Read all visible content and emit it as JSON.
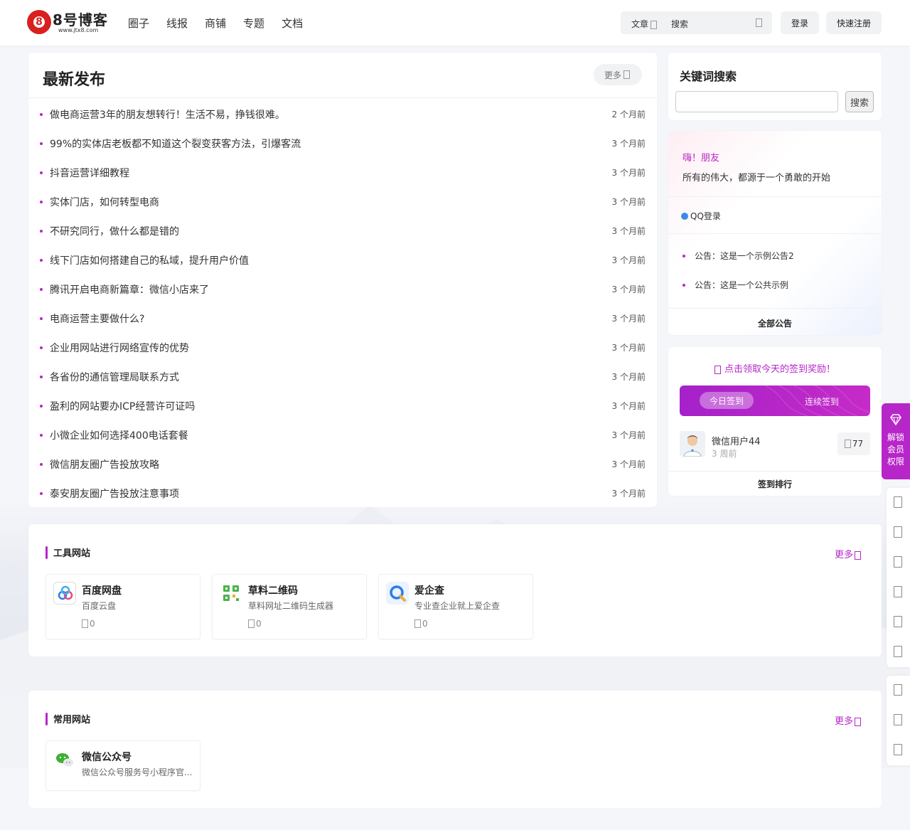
{
  "header": {
    "logo_text": "8号博客",
    "logo_sub": "www.jtx8.com",
    "nav": [
      "圈子",
      "线报",
      "商铺",
      "专题",
      "文档"
    ],
    "search_type": "文章",
    "search_placeholder": "搜索",
    "login": "登录",
    "register": "快速注册"
  },
  "latest": {
    "title": "最新发布",
    "more": "更多",
    "posts": [
      {
        "title": "做电商运营3年的朋友想转行！生活不易，挣钱很难。",
        "time": "2 个月前"
      },
      {
        "title": "99%的实体店老板都不知道这个裂变获客方法，引爆客流",
        "time": "3 个月前"
      },
      {
        "title": "抖音运营详细教程",
        "time": "3 个月前"
      },
      {
        "title": "实体门店，如何转型电商",
        "time": "3 个月前"
      },
      {
        "title": "不研究同行，做什么都是错的",
        "time": "3 个月前"
      },
      {
        "title": "线下门店如何搭建自己的私域，提升用户价值",
        "time": "3 个月前"
      },
      {
        "title": "腾讯开启电商新篇章：微信小店来了",
        "time": "3 个月前"
      },
      {
        "title": "电商运营主要做什么?",
        "time": "3 个月前"
      },
      {
        "title": "企业用网站进行网络宣传的优势",
        "time": "3 个月前"
      },
      {
        "title": "各省份的通信管理局联系方式",
        "time": "3 个月前"
      },
      {
        "title": "盈利的网站要办ICP经营许可证吗",
        "time": "3 个月前"
      },
      {
        "title": "小微企业如何选择400电话套餐",
        "time": "3 个月前"
      },
      {
        "title": "微信朋友圈广告投放攻略",
        "time": "3 个月前"
      },
      {
        "title": "泰安朋友圈广告投放注意事项",
        "time": "3 个月前"
      }
    ]
  },
  "keyword": {
    "title": "关键词搜索",
    "button": "搜索",
    "value": ""
  },
  "welcome": {
    "greeting": "嗨！朋友",
    "motto": "所有的伟大，都源于一个勇敢的开始",
    "qq_login": "QQ登录",
    "notices": [
      "公告：这是一个示例公告2",
      "公告：这是一个公共示例"
    ],
    "all_notices": "全部公告"
  },
  "signin": {
    "tip": "点击领取今天的签到奖励！",
    "today": "今日签到",
    "continuous": "连续签到",
    "user_name": "微信用户44",
    "user_time": "3 周前",
    "user_points": "77",
    "rank": "签到排行"
  },
  "tools": {
    "title": "工具网站",
    "more": "更多",
    "sites": [
      {
        "name": "百度网盘",
        "desc": "百度云盘",
        "views": "0"
      },
      {
        "name": "草料二维码",
        "desc": "草料网址二维码生成器",
        "views": "0"
      },
      {
        "name": "爱企查",
        "desc": "专业查企业就上爱企查",
        "views": "0"
      }
    ]
  },
  "common": {
    "title": "常用网站",
    "more": "更多",
    "sites": [
      {
        "name": "微信公众号",
        "desc": "微信公众号服务号小程序官..."
      }
    ]
  },
  "vip": {
    "line1": "解锁",
    "line2": "会员",
    "line3": "权限"
  },
  "colors": {
    "accent": "#b726c8",
    "qq_blue": "#3d8ae6",
    "logo_red": "#d8201f"
  }
}
